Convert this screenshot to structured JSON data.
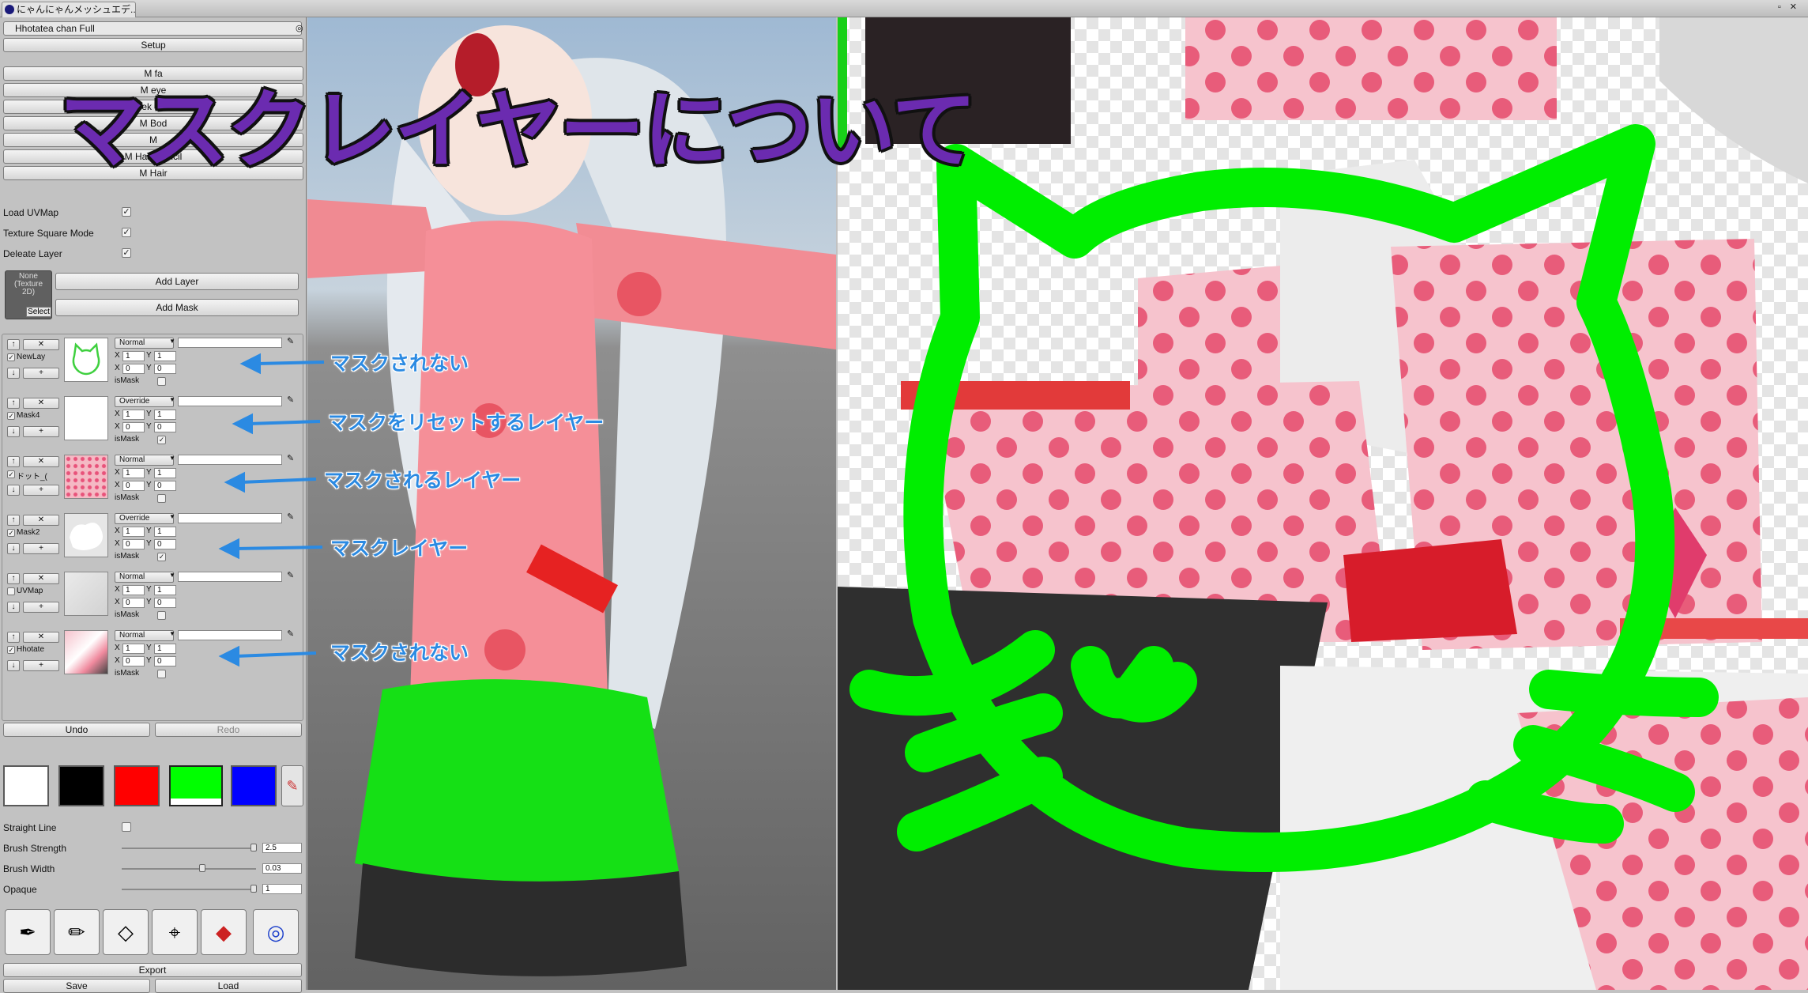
{
  "window": {
    "tab_title": "にゃんにゃんメッシュエデ..."
  },
  "panel": {
    "object_name": "Hhotatea chan Full",
    "setup": "Setup",
    "materials": [
      "M fa",
      "M eye",
      "cheek namid",
      "M Bod",
      "M",
      "M Hair stencil",
      "M Hair"
    ],
    "options": [
      {
        "label": "Load UVMap",
        "checked": true
      },
      {
        "label": "Texture Square Mode",
        "checked": true
      },
      {
        "label": "Deleate Layer",
        "checked": true
      }
    ],
    "texture_slot": {
      "text": "None (Texture 2D)",
      "select": "Select"
    },
    "add_layer": "Add Layer",
    "add_mask": "Add Mask",
    "layers": [
      {
        "name": "NewLay",
        "blend": "Normal",
        "x": "1",
        "y": "1",
        "ox": "0",
        "oy": "0",
        "is_mask_label": "isMask",
        "is_mask": false,
        "visible": true
      },
      {
        "name": "Mask4",
        "blend": "Override",
        "x": "1",
        "y": "1",
        "ox": "0",
        "oy": "0",
        "is_mask_label": "isMask",
        "is_mask": true,
        "visible": true
      },
      {
        "name": "ドット_(",
        "blend": "Normal",
        "x": "1",
        "y": "1",
        "ox": "0",
        "oy": "0",
        "is_mask_label": "isMask",
        "is_mask": false,
        "visible": true
      },
      {
        "name": "Mask2",
        "blend": "Override",
        "x": "1",
        "y": "1",
        "ox": "0",
        "oy": "0",
        "is_mask_label": "isMask",
        "is_mask": true,
        "visible": true
      },
      {
        "name": "UVMap",
        "blend": "Normal",
        "x": "1",
        "y": "1",
        "ox": "0",
        "oy": "0",
        "is_mask_label": "isMask",
        "is_mask": false,
        "visible": false
      },
      {
        "name": "Hhotate",
        "blend": "Normal",
        "x": "1",
        "y": "1",
        "ox": "0",
        "oy": "0",
        "is_mask_label": "isMask",
        "is_mask": false,
        "visible": true
      }
    ],
    "undo": "Undo",
    "redo": "Redo",
    "swatch_colors": [
      "#ffffff",
      "#000000",
      "#ff0000",
      "#00ff00",
      "#0000ff"
    ],
    "selected_swatch": 3,
    "straight_line": "Straight Line",
    "brush_strength": {
      "label": "Brush Strength",
      "value": "2.5",
      "fraction": 0.98
    },
    "brush_width": {
      "label": "Brush Width",
      "value": "0.03",
      "fraction": 0.6
    },
    "opaque": {
      "label": "Opaque",
      "value": "1",
      "fraction": 0.98
    },
    "tools": [
      "pen-icon",
      "eraser-icon",
      "fill-icon",
      "stamp-icon",
      "bucket-icon",
      "spoit-icon"
    ],
    "export": "Export",
    "save": "Save",
    "load": "Load"
  },
  "overlay": {
    "title": "マスクレイヤーについて",
    "annotations": [
      "マスクされない",
      "マスクをリセットするレイヤー",
      "マスクされるレイヤー",
      "マスクレイヤー",
      "マスクされない"
    ],
    "accent": "#6b2bb0",
    "annotation_color": "#2b8ae2",
    "paint_color": "#00ee00"
  }
}
